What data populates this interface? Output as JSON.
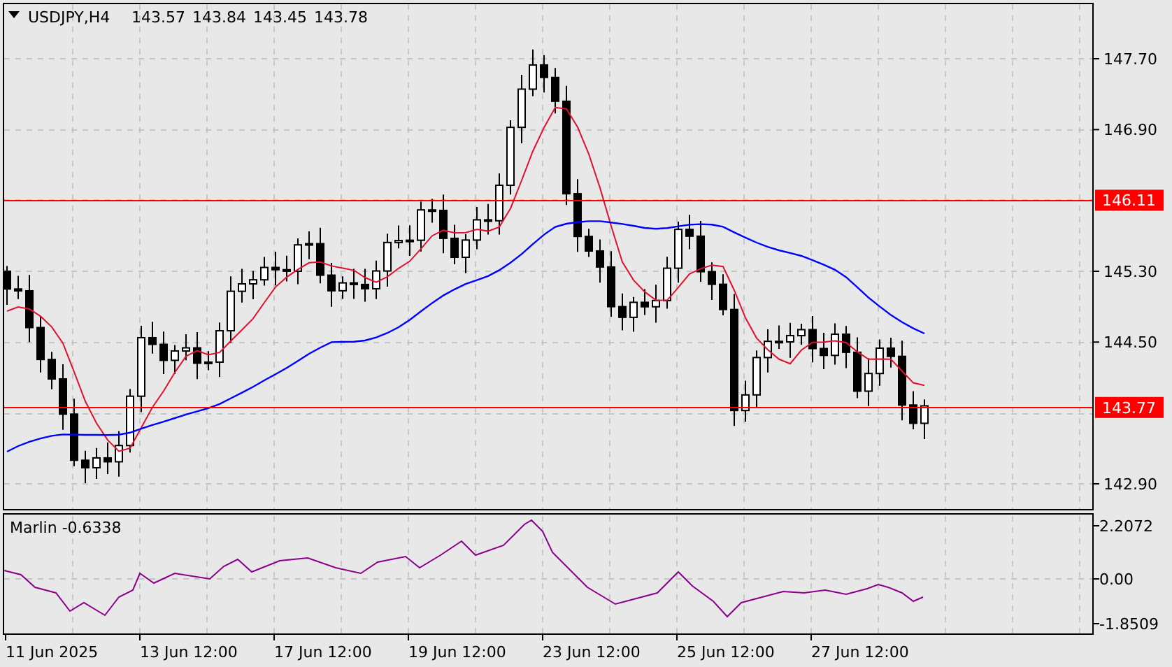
{
  "header": {
    "symbol": "USDJPY,H4",
    "quote": [
      "143.57",
      "143.84",
      "143.45",
      "143.78"
    ]
  },
  "price_axis": {
    "labels": [
      "147.70",
      "146.90",
      "145.30",
      "144.50",
      "142.90"
    ]
  },
  "levels": [
    {
      "label": "146.11"
    },
    {
      "label": "143.77"
    }
  ],
  "indicator": {
    "label": "Marlin -0.6338",
    "axis_labels": [
      "2.2072",
      "0.00",
      "-1.8509"
    ]
  },
  "time_axis": [
    "11 Jun 2025",
    "13 Jun 12:00",
    "17 Jun 12:00",
    "19 Jun 12:00",
    "23 Jun 12:00",
    "25 Jun 12:00",
    "27 Jun 12:00"
  ]
}
